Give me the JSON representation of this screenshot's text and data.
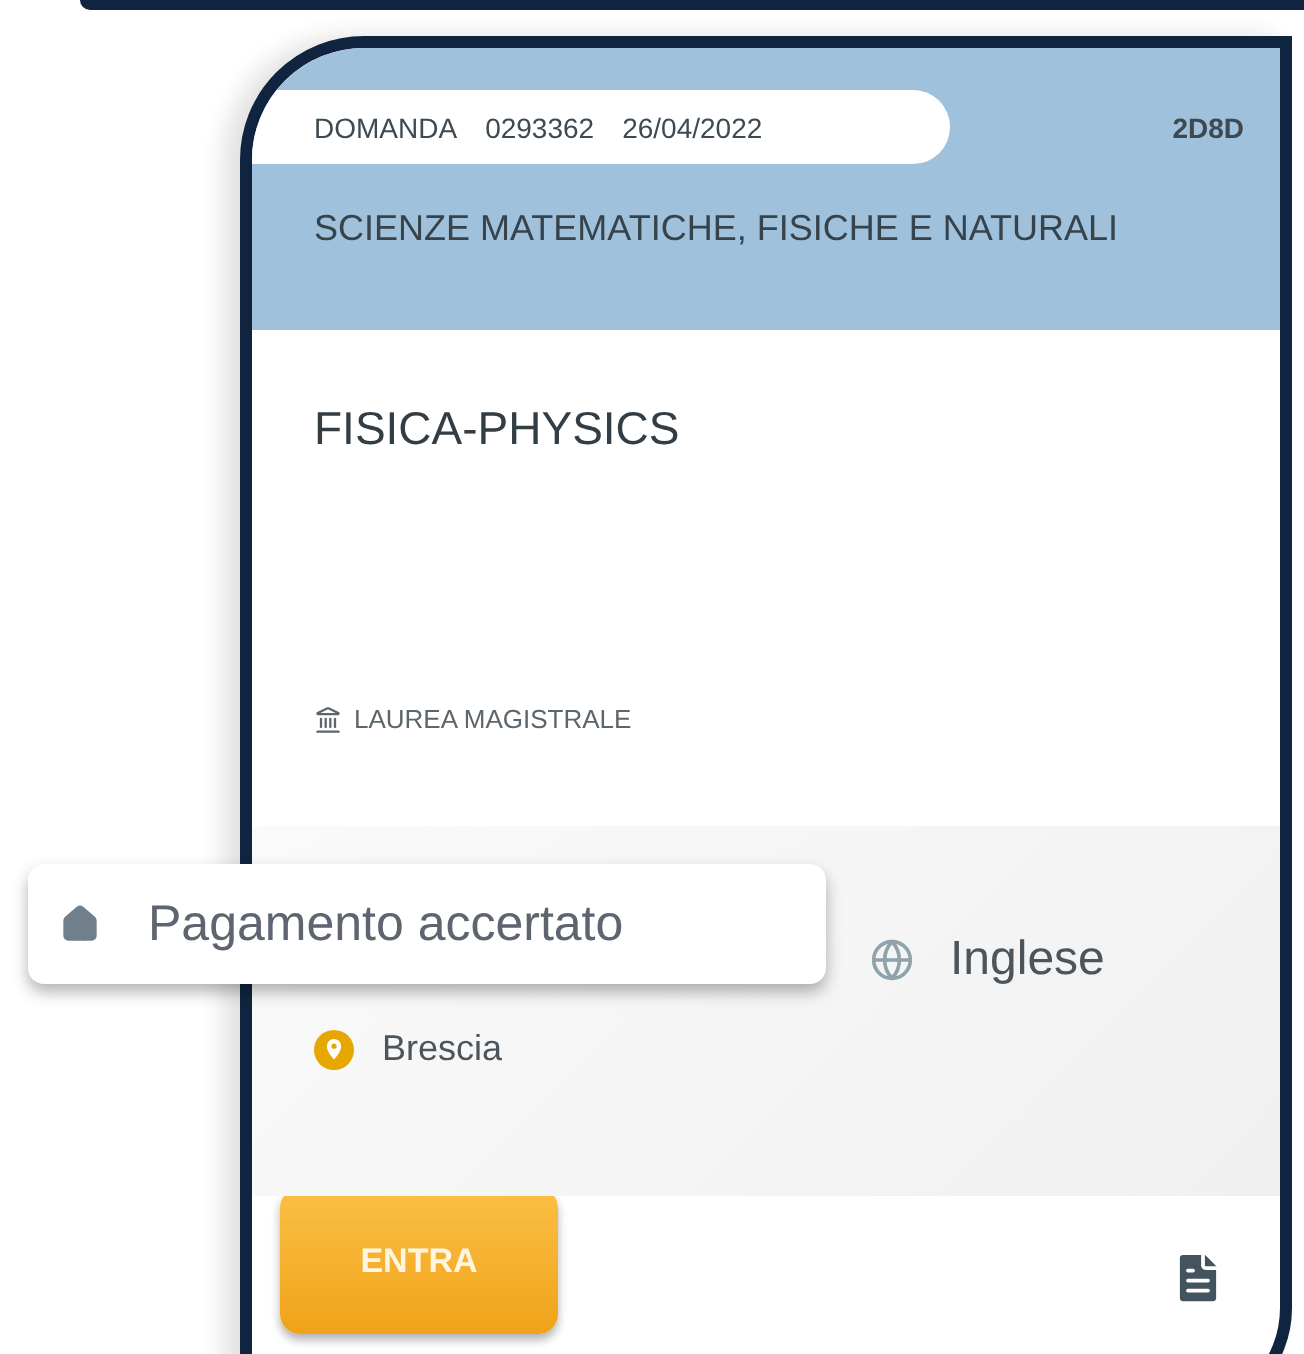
{
  "header": {
    "label": "DOMANDA",
    "number": "0293362",
    "date": "26/04/2022",
    "code": "2D8D",
    "faculty": "SCIENZE MATEMATICHE, FISICHE E NATURALI"
  },
  "course": {
    "title": "FISICA-PHYSICS",
    "degree": "LAUREA MAGISTRALE"
  },
  "details": {
    "language": "Inglese",
    "location": "Brescia"
  },
  "status_tooltip": {
    "text": "Pagamento accertato"
  },
  "actions": {
    "primary_button": "ENTRA"
  }
}
